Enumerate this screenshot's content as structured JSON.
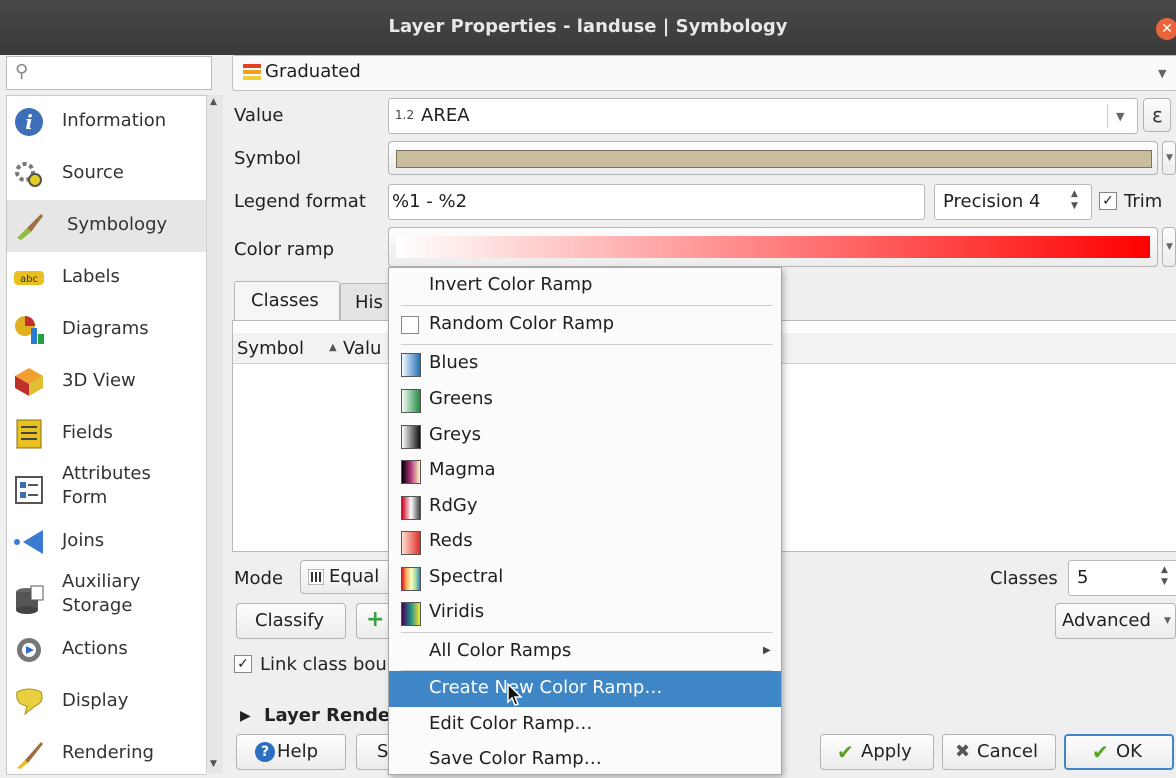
{
  "window": {
    "title": "Layer Properties - landuse | Symbology",
    "close_glyph": "✕"
  },
  "sidebar": {
    "search_placeholder": "",
    "items": [
      {
        "label": "Information",
        "icon": "info-icon"
      },
      {
        "label": "Source",
        "icon": "source-icon"
      },
      {
        "label": "Symbology",
        "icon": "symbology-icon",
        "selected": true
      },
      {
        "label": "Labels",
        "icon": "labels-icon"
      },
      {
        "label": "Diagrams",
        "icon": "diagrams-icon"
      },
      {
        "label": "3D View",
        "icon": "3d-view-icon"
      },
      {
        "label": "Fields",
        "icon": "fields-icon"
      },
      {
        "label": "Attributes\nForm",
        "icon": "attributes-form-icon"
      },
      {
        "label": "Joins",
        "icon": "joins-icon"
      },
      {
        "label": "Auxiliary\nStorage",
        "icon": "auxiliary-storage-icon"
      },
      {
        "label": "Actions",
        "icon": "actions-icon"
      },
      {
        "label": "Display",
        "icon": "display-icon"
      },
      {
        "label": "Rendering",
        "icon": "rendering-icon"
      }
    ]
  },
  "renderer": {
    "type": "Graduated"
  },
  "form": {
    "value_label": "Value",
    "value_prefix": "1.2",
    "value": "AREA",
    "epsilon": "ε",
    "symbol_label": "Symbol",
    "symbol_color": "#c8bd9c",
    "legend_label": "Legend format",
    "legend_value": "%1 - %2",
    "precision": "Precision 4",
    "trim_label": "Trim",
    "trim_checked": true,
    "ramp_label": "Color ramp"
  },
  "tabs": [
    "Classes",
    "His"
  ],
  "table": {
    "col_symbol": "Symbol",
    "col_value": "Valu",
    "sort_glyph": "▲"
  },
  "mode": {
    "label": "Mode",
    "value": "Equal"
  },
  "classes": {
    "label": "Classes",
    "value": "5"
  },
  "buttons": {
    "classify": "Classify",
    "add_glyph": "+",
    "advanced": "Advanced",
    "link_class": "Link class bou",
    "layer_render": "Layer Rende",
    "help": "Help",
    "s_partial": "S",
    "apply": "Apply",
    "cancel": "Cancel",
    "ok": "OK"
  },
  "menu": {
    "invert": "Invert Color Ramp",
    "random": "Random Color Ramp",
    "ramps": [
      {
        "label": "Blues",
        "gradient": "linear-gradient(90deg,#f7fbff,#2070b4)"
      },
      {
        "label": "Greens",
        "gradient": "linear-gradient(90deg,#f7fcf5,#238b45)"
      },
      {
        "label": "Greys",
        "gradient": "linear-gradient(90deg,#ffffff,#111111)"
      },
      {
        "label": "Magma",
        "gradient": "linear-gradient(90deg,#000004,#b5367a,#fcfdbf)"
      },
      {
        "label": "RdGy",
        "gradient": "linear-gradient(90deg,#ca0020,#ffffff,#404040)"
      },
      {
        "label": "Reds",
        "gradient": "linear-gradient(90deg,#fee0d2,#de2d26)"
      },
      {
        "label": "Spectral",
        "gradient": "linear-gradient(90deg,#d7191c,#fdae61,#ffffbf,#abdda4,#2b83ba)"
      },
      {
        "label": "Viridis",
        "gradient": "linear-gradient(90deg,#440154,#21918c,#fde725)"
      }
    ],
    "all": "All Color Ramps",
    "create": "Create New Color Ramp…",
    "edit": "Edit Color Ramp…",
    "save": "Save Color Ramp…"
  }
}
